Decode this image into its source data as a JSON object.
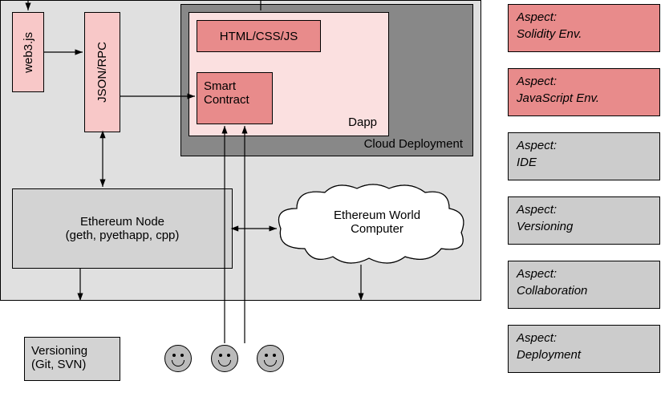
{
  "main_container": {},
  "web3": {
    "label": "web3.js"
  },
  "jsonrpc": {
    "label": "JSON/RPC"
  },
  "cloud_deploy": {
    "label": "Cloud Deployment"
  },
  "dapp": {
    "label": "Dapp"
  },
  "htmlcssjs": {
    "label": "HTML/CSS/JS"
  },
  "smart_contract": {
    "label": "Smart\nContract"
  },
  "eth_node": {
    "label": "Ethereum Node\n(geth, pyethapp, cpp)"
  },
  "world_computer": {
    "label": "Ethereum World\nComputer"
  },
  "versioning_box": {
    "label": "Versioning\n(Git, SVN)"
  },
  "aspects": [
    {
      "label": "Aspect:\nSolidity Env."
    },
    {
      "label": "Aspect:\nJavaScript Env."
    },
    {
      "label": "Aspect:\nIDE"
    },
    {
      "label": "Aspect:\nVersioning"
    },
    {
      "label": "Aspect:\nCollaboration"
    },
    {
      "label": "Aspect:\nDeployment"
    }
  ]
}
